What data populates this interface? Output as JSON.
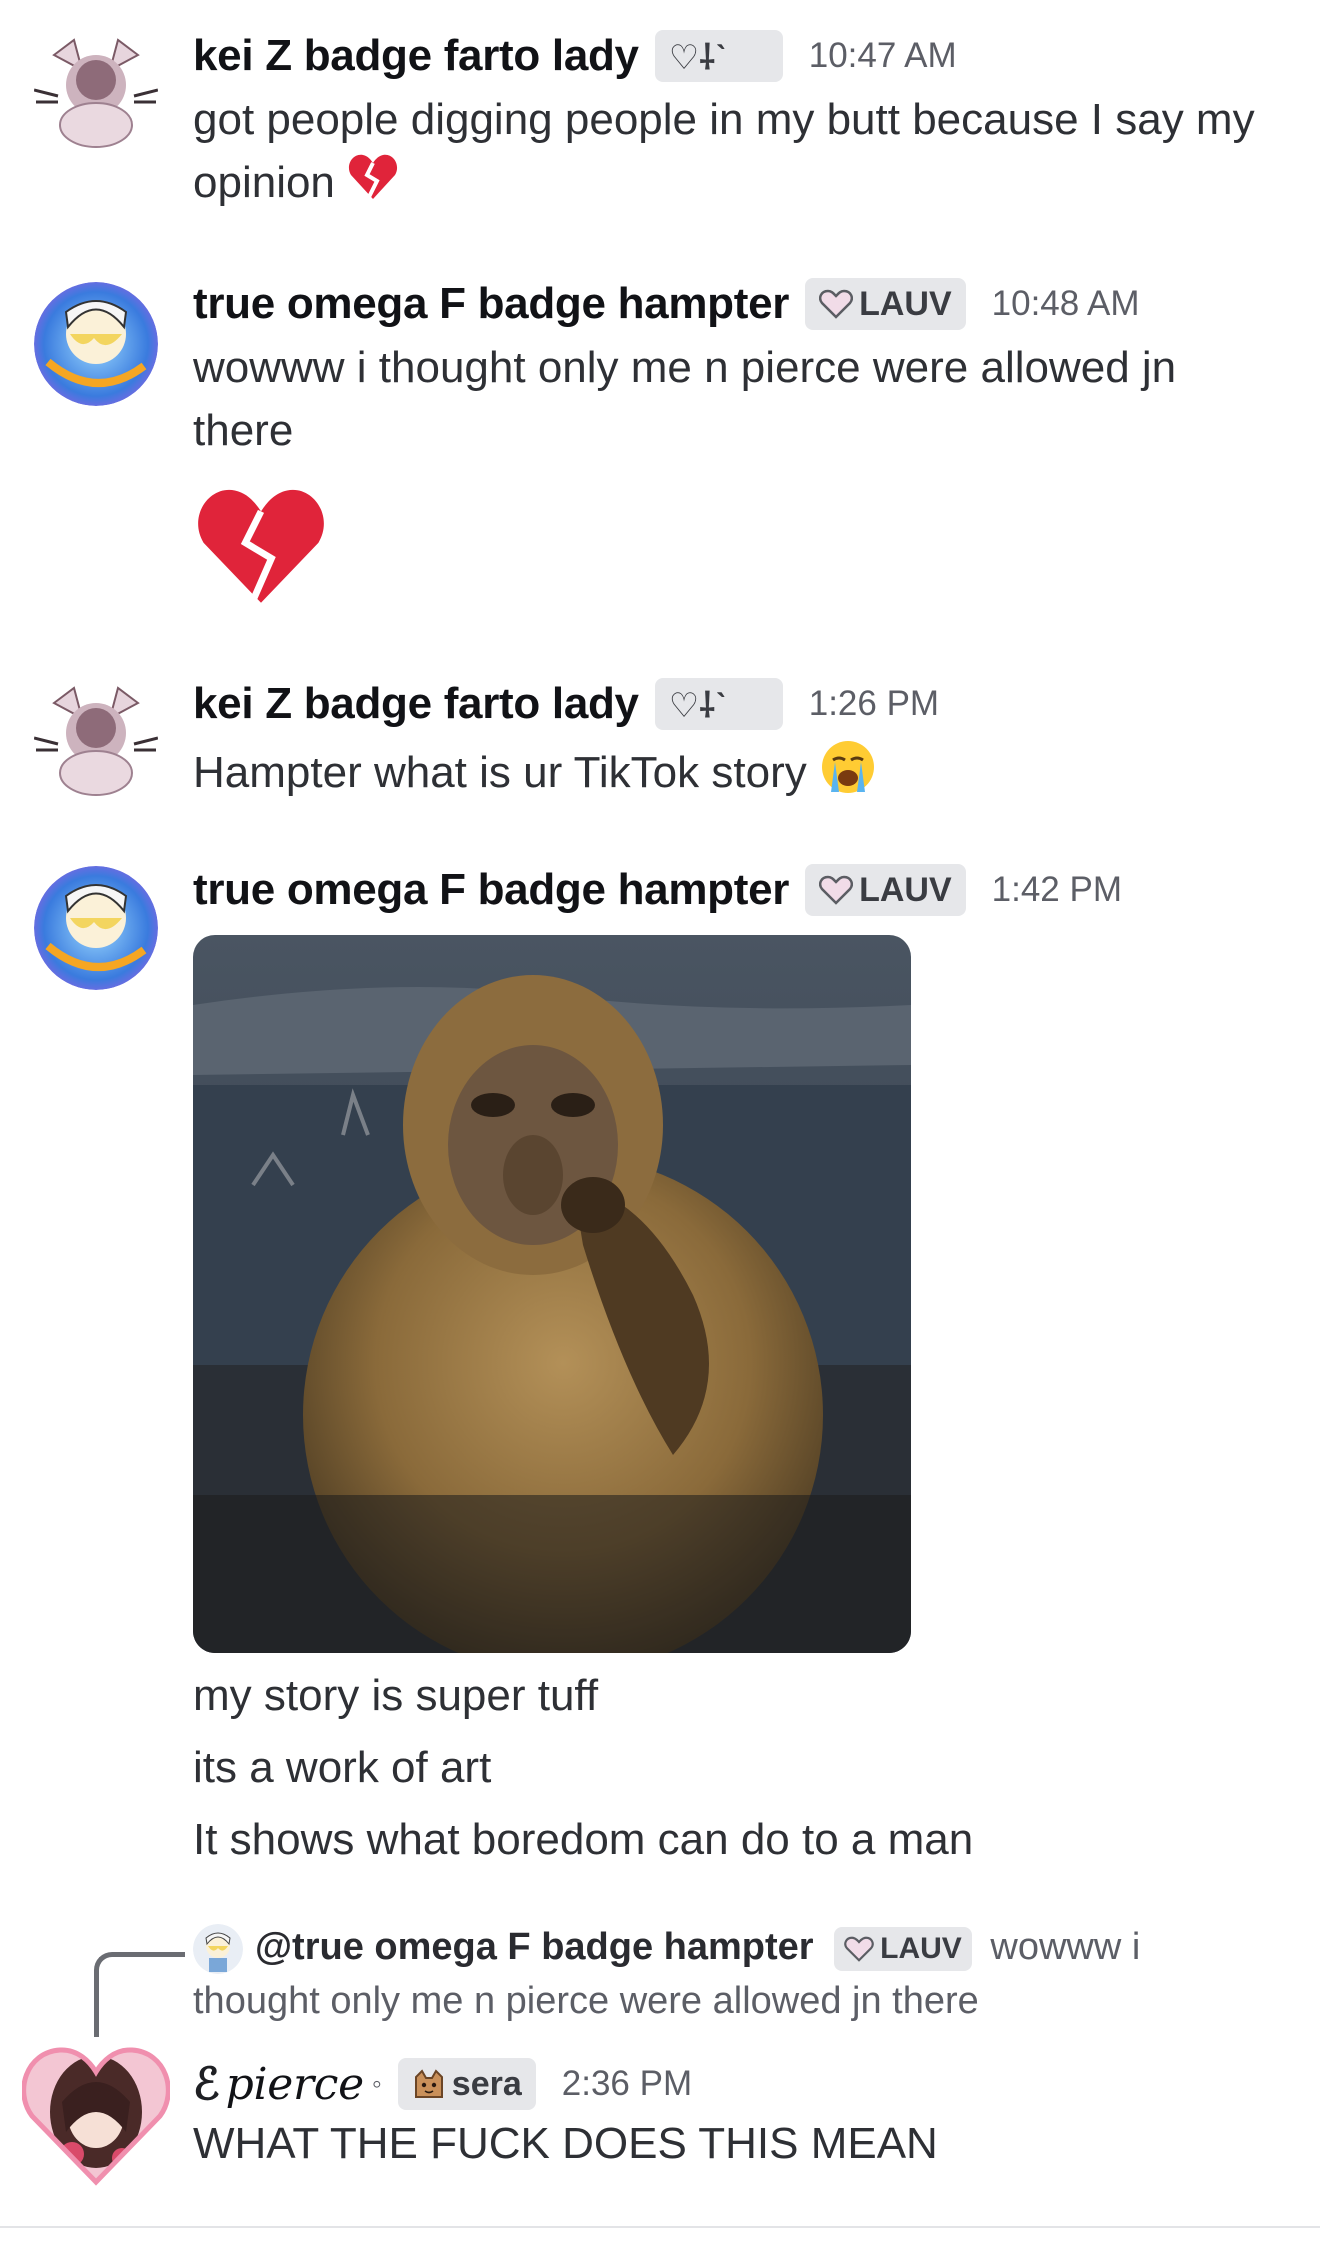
{
  "messages": [
    {
      "username": "kei Z badge farto lady",
      "tag": "♡⸸ˋ",
      "time": "10:47 AM",
      "lines": [
        "got people digging people in my butt because I say my",
        "opinion"
      ]
    },
    {
      "username": "true omega F badge hampter",
      "tag": "LAUV",
      "time": "10:48 AM",
      "lines": [
        "wowww i thought only me n pierce were allowed jn",
        "there"
      ]
    },
    {
      "username": "kei Z badge farto lady",
      "tag": "♡⸸ˋ",
      "time": "1:26 PM",
      "lines": [
        "Hampter what is ur TikTok story"
      ]
    },
    {
      "username": "true omega F badge hampter",
      "tag": "LAUV",
      "time": "1:42 PM",
      "lines": [
        "my story is super tuff",
        "its a work of art",
        "It shows what boredom can do to a man"
      ]
    },
    {
      "username": "pierce",
      "tag": "sera",
      "time": "2:36 PM",
      "lines": [
        "WHAT THE FUCK DOES THIS MEAN"
      ],
      "reply": {
        "username": "@true omega F badge hampter",
        "tag": "LAUV",
        "text_part1": "wowww i",
        "text_part2": "thought only me n pierce were allowed jn there"
      }
    }
  ],
  "icons": {
    "broken_heart": "broken-heart-emoji",
    "crying": "loudly-crying-emoji",
    "guild_heart": "heart-icon",
    "cat": "cat-icon"
  },
  "colors": {
    "tag_bg": "#e6e7ea",
    "heart_red": "#e0243a",
    "muted_text": "#5c5e66"
  }
}
